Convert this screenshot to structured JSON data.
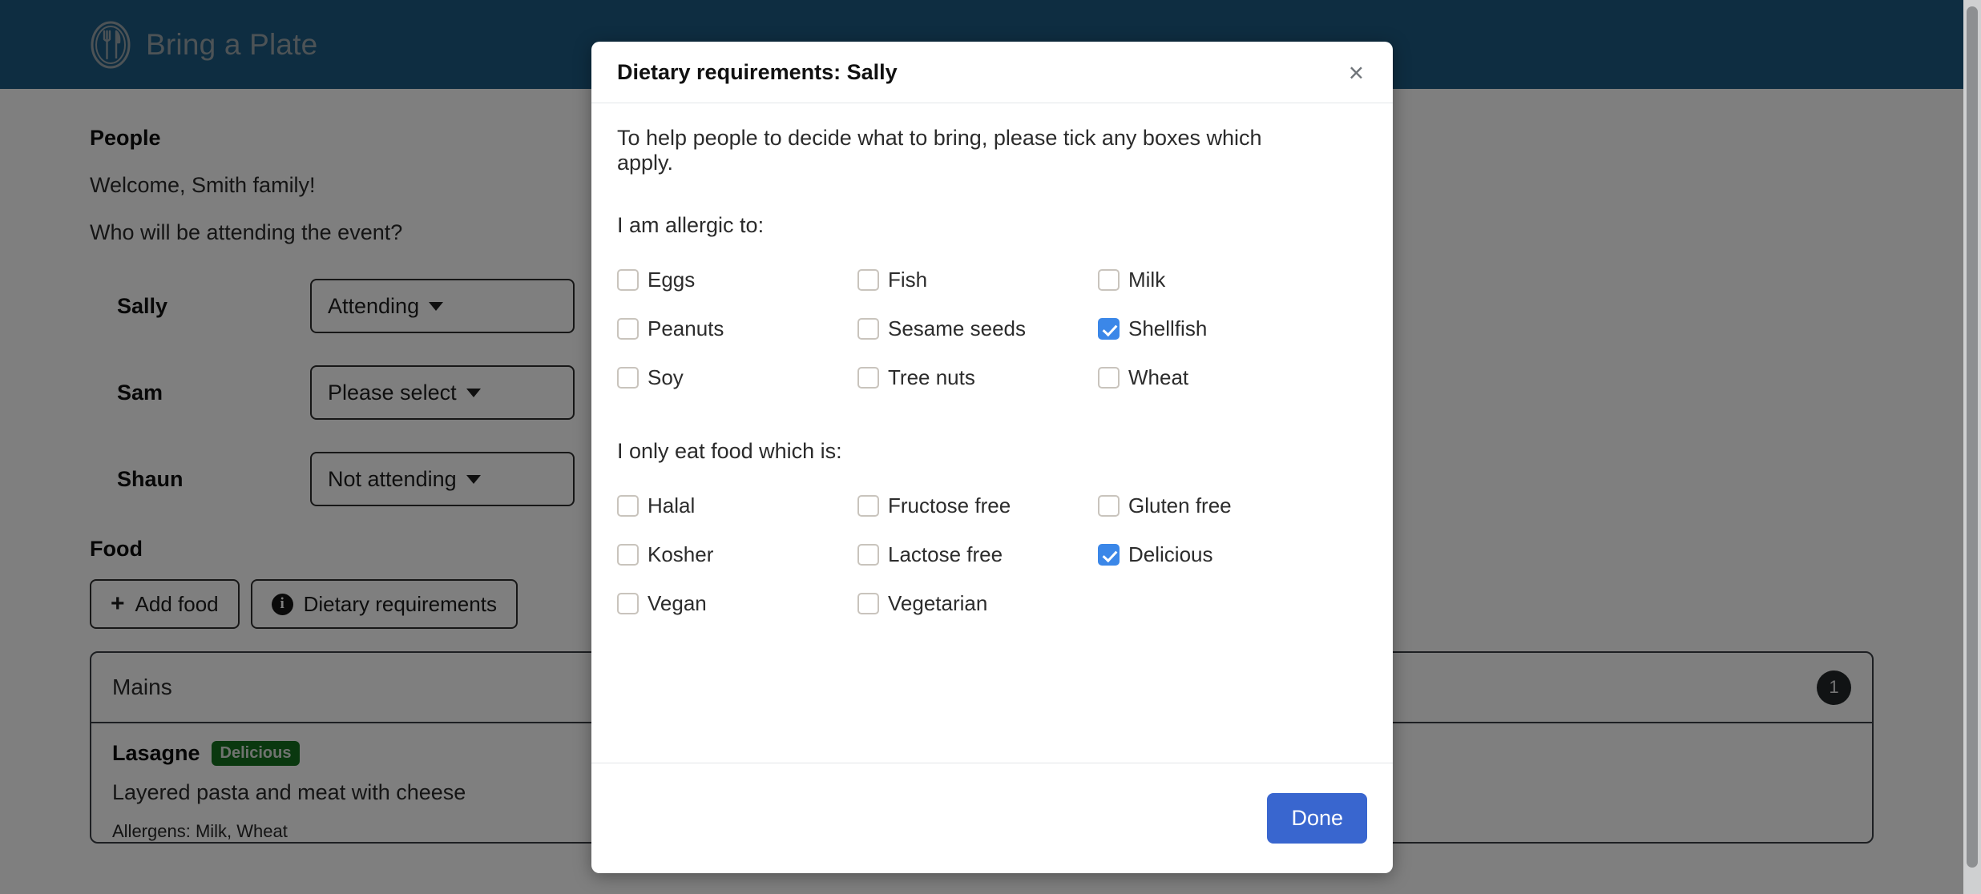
{
  "app": {
    "brand_name": "Bring a Plate",
    "logo_icon": "fork-and-knife-plate-icon",
    "header_color": "#1d5a82"
  },
  "people_section": {
    "title": "People",
    "welcome": "Welcome, Smith family!",
    "question": "Who will be attending the event?",
    "rows": [
      {
        "name": "Sally",
        "attendance": "Attending"
      },
      {
        "name": "Sam",
        "attendance": "Please select"
      },
      {
        "name": "Shaun",
        "attendance": "Not attending"
      }
    ]
  },
  "food_section": {
    "title": "Food",
    "add_food_label": "Add food",
    "add_food_icon": "plus-icon",
    "dietary_requirements_label": "Dietary requirements",
    "dietary_requirements_icon": "info-circle-icon",
    "card": {
      "header_title": "Mains",
      "count_badge": "1",
      "dish": {
        "name": "Lasagne",
        "badge": "Delicious",
        "badge_color": "#15701f",
        "description": "Layered pasta and meat with cheese",
        "allergens": "Allergens: Milk, Wheat"
      }
    }
  },
  "modal": {
    "title": "Dietary requirements: Sally",
    "close_icon": "close-icon",
    "close_label": "×",
    "intro": "To help people to decide what to bring, please tick any boxes which apply.",
    "allergy_label": "I am allergic to:",
    "allergy_options": [
      {
        "label": "Eggs",
        "checked": false
      },
      {
        "label": "Fish",
        "checked": false
      },
      {
        "label": "Milk",
        "checked": false
      },
      {
        "label": "Peanuts",
        "checked": false
      },
      {
        "label": "Sesame seeds",
        "checked": false
      },
      {
        "label": "Shellfish",
        "checked": true
      },
      {
        "label": "Soy",
        "checked": false
      },
      {
        "label": "Tree nuts",
        "checked": false
      },
      {
        "label": "Wheat",
        "checked": false
      }
    ],
    "diet_label": "I only eat food which is:",
    "diet_options": [
      {
        "label": "Halal",
        "checked": false
      },
      {
        "label": "Fructose free",
        "checked": false
      },
      {
        "label": "Gluten free",
        "checked": false
      },
      {
        "label": "Kosher",
        "checked": false
      },
      {
        "label": "Lactose free",
        "checked": false
      },
      {
        "label": "Delicious",
        "checked": true
      },
      {
        "label": "Vegan",
        "checked": false
      },
      {
        "label": "Vegetarian",
        "checked": false
      }
    ],
    "done_label": "Done",
    "done_color": "#3966cf",
    "checked_color": "#3b87e8"
  }
}
